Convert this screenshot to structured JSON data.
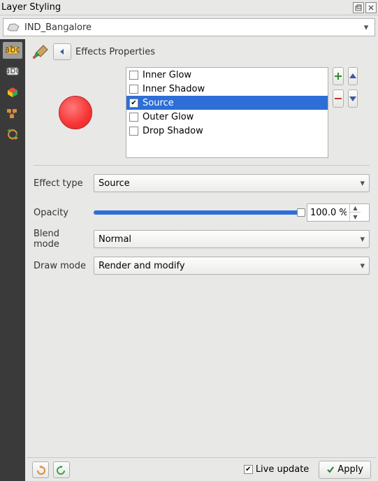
{
  "title": "Layer Styling",
  "layer_name": "IND_Bangalore",
  "header_label": "Effects Properties",
  "preview_color": "#f73434",
  "effects": [
    {
      "label": "Inner Glow",
      "checked": false,
      "selected": false
    },
    {
      "label": "Inner Shadow",
      "checked": false,
      "selected": false
    },
    {
      "label": "Source",
      "checked": true,
      "selected": true
    },
    {
      "label": "Outer Glow",
      "checked": false,
      "selected": false
    },
    {
      "label": "Drop Shadow",
      "checked": false,
      "selected": false
    }
  ],
  "form": {
    "effect_type_label": "Effect type",
    "effect_type_value": "Source",
    "opacity_label": "Opacity",
    "opacity_value": "100.0 %",
    "opacity_percent": 100,
    "blend_label": "Blend mode",
    "blend_value": "Normal",
    "draw_label": "Draw mode",
    "draw_value": "Render and modify"
  },
  "footer": {
    "live_update_label": "Live update",
    "live_update_checked": true,
    "apply_label": "Apply"
  }
}
